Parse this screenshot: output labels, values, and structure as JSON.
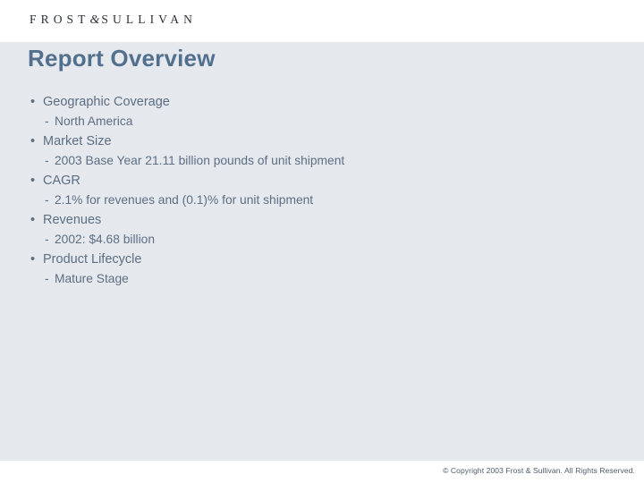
{
  "header": {
    "logo_text": "FROST",
    "logo_amp": "&",
    "logo_text2": "SULLIVAN"
  },
  "slide": {
    "title": "Report Overview"
  },
  "outline": [
    {
      "level": 1,
      "marker": "•",
      "text": "Geographic Coverage"
    },
    {
      "level": 2,
      "marker": "-",
      "text": "North America"
    },
    {
      "level": 1,
      "marker": "•",
      "text": "Market Size"
    },
    {
      "level": 2,
      "marker": "-",
      "text": "2003 Base Year 21.11 billion pounds of unit shipment"
    },
    {
      "level": 1,
      "marker": "•",
      "text": "CAGR"
    },
    {
      "level": 2,
      "marker": "-",
      "text": "2.1% for revenues and (0.1)% for unit shipment"
    },
    {
      "level": 1,
      "marker": "•",
      "text": "Revenues"
    },
    {
      "level": 2,
      "marker": "-",
      "text": "2002: $4.68 billion"
    },
    {
      "level": 1,
      "marker": "•",
      "text": "Product Lifecycle"
    },
    {
      "level": 2,
      "marker": "-",
      "text": "Mature Stage"
    }
  ],
  "footer": {
    "copyright": "© Copyright 2003 Frost & Sullivan. All Rights Reserved."
  },
  "colors": {
    "title": "#52708e",
    "body_text": "#5d6e83",
    "panel_bg": "#e5e8ed",
    "header_bg": "#ffffff",
    "logo": "#2b2f38"
  }
}
